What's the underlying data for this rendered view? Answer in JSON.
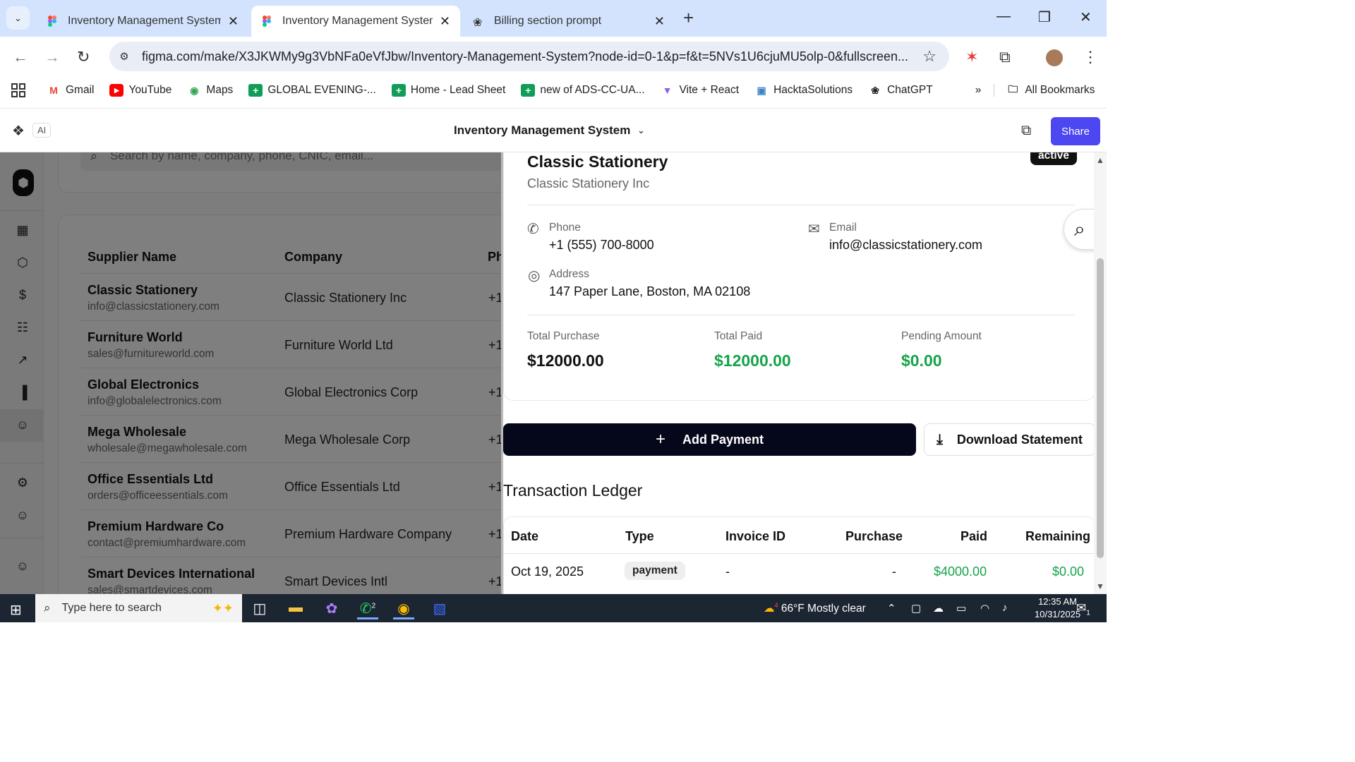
{
  "browser": {
    "tabs": [
      {
        "title": "Inventory Management System",
        "active": false
      },
      {
        "title": "Inventory Management System",
        "active": true
      },
      {
        "title": "Billing section prompt",
        "active": false
      }
    ],
    "url": "figma.com/make/X3JKWMy9g3VbNFa0eVfJbw/Inventory-Management-System?node-id=0-1&p=f&t=5NVs1U6cjuMU5olp-0&fullscreen...",
    "bookmarks": [
      "Gmail",
      "YouTube",
      "Maps",
      "GLOBAL EVENING-...",
      "Home - Lead Sheet",
      "new of ADS-CC-UA...",
      "Vite + React",
      "HacktaSolutions",
      "ChatGPT"
    ],
    "all_bookmarks": "All Bookmarks"
  },
  "figma": {
    "ai_badge": "AI",
    "title": "Inventory Management System",
    "share": "Share"
  },
  "suppliers": {
    "search_placeholder": "Search by name, company, phone, CNIC, email...",
    "columns": [
      "Supplier Name",
      "Company",
      "Ph"
    ],
    "rows": [
      {
        "name": "Classic Stationery",
        "email": "info@classicstationery.com",
        "company": "Classic Stationery Inc",
        "phone": "+1"
      },
      {
        "name": "Furniture World",
        "email": "sales@furnitureworld.com",
        "company": "Furniture World Ltd",
        "phone": "+1"
      },
      {
        "name": "Global Electronics",
        "email": "info@globalelectronics.com",
        "company": "Global Electronics Corp",
        "phone": "+1"
      },
      {
        "name": "Mega Wholesale",
        "email": "wholesale@megawholesale.com",
        "company": "Mega Wholesale Corp",
        "phone": "+1"
      },
      {
        "name": "Office Essentials Ltd",
        "email": "orders@officeessentials.com",
        "company": "Office Essentials Ltd",
        "phone": "+1"
      },
      {
        "name": "Premium Hardware Co",
        "email": "contact@premiumhardware.com",
        "company": "Premium Hardware Company",
        "phone": "+1"
      },
      {
        "name": "Smart Devices International",
        "email": "sales@smartdevices.com",
        "company": "Smart Devices Intl",
        "phone": "+1"
      }
    ]
  },
  "detail": {
    "name": "Classic Stationery",
    "company": "Classic Stationery Inc",
    "status": "active",
    "phone_label": "Phone",
    "phone": "+1 (555) 700-8000",
    "email_label": "Email",
    "email": "info@classicstationery.com",
    "address_label": "Address",
    "address": "147 Paper Lane, Boston, MA 02108",
    "total_purchase_label": "Total Purchase",
    "total_purchase": "$12000.00",
    "total_paid_label": "Total Paid",
    "total_paid": "$12000.00",
    "pending_label": "Pending Amount",
    "pending": "$0.00",
    "add_payment": "Add Payment",
    "download_statement": "Download Statement",
    "ledger_title": "Transaction Ledger",
    "ledger_columns": [
      "Date",
      "Type",
      "Invoice ID",
      "Purchase",
      "Paid",
      "Remaining"
    ],
    "ledger_rows": [
      {
        "date": "Oct 19, 2025",
        "type": "payment",
        "invoice": "-",
        "purchase": "-",
        "paid": "$4000.00",
        "remaining": "$0.00"
      }
    ],
    "accent_green": "#16a34a"
  },
  "taskbar": {
    "search_placeholder": "Type here to search",
    "whatsapp_badge": "2",
    "weather_badge": "4",
    "weather": "66°F  Mostly clear",
    "time": "12:35 AM",
    "date": "10/31/2025",
    "notifications": "1"
  }
}
